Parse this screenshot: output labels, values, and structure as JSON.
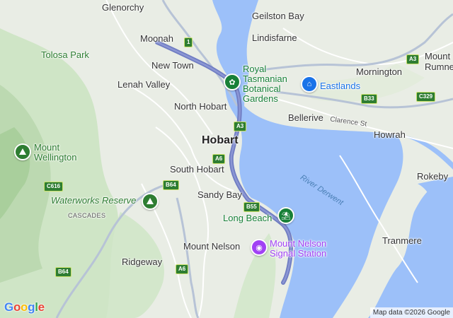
{
  "map": {
    "suburbs": {
      "glenorchy": "Glenorchy",
      "geilston_bay": "Geilston Bay",
      "moonah": "Moonah",
      "lindisfarne": "Lindisfarne",
      "tolosa_park": "Tolosa Park",
      "mount_rumney": "Mount\nRumney",
      "new_town": "New Town",
      "mornington": "Mornington",
      "lenah_valley": "Lenah Valley",
      "north_hobart": "North Hobart",
      "bellerive": "Bellerive",
      "hobart": "Hobart",
      "howrah": "Howrah",
      "south_hobart": "South Hobart",
      "rokeby": "Rokeby",
      "sandy_bay": "Sandy Bay",
      "cascades": "CASCADES",
      "tranmere": "Tranmere",
      "mount_nelson": "Mount Nelson",
      "ridgeway": "Ridgeway"
    },
    "parks": {
      "mount_wellington": "Mount\nWellington",
      "waterworks_reserve": "Waterworks Reserve"
    },
    "water": {
      "river_derwent": "River Derwent"
    },
    "pois": {
      "botanical_gardens": "Royal\nTasmanian\nBotanical\nGardens",
      "eastlands": "Eastlands",
      "long_beach": "Long Beach",
      "signal_station": "Mount Nelson\nSignal Station"
    },
    "streets": {
      "clarence_st": "Clarence St"
    },
    "shields": {
      "r1": "1",
      "a3_north": "A3",
      "a3_east": "A3",
      "b33": "B33",
      "c329": "C329",
      "a6_hobart": "A6",
      "b64": "B64",
      "c616": "C616",
      "b55": "B55",
      "a6_south": "A6",
      "b64_west": "B64"
    },
    "attribution": "Map data ©2026 Google",
    "logo_letters": [
      "G",
      "o",
      "o",
      "g",
      "l",
      "e"
    ],
    "colors": {
      "water": "#9cc0f9",
      "route": "#6f7cc2",
      "land": "#e8ece4",
      "park": "#c8e6c0"
    }
  }
}
